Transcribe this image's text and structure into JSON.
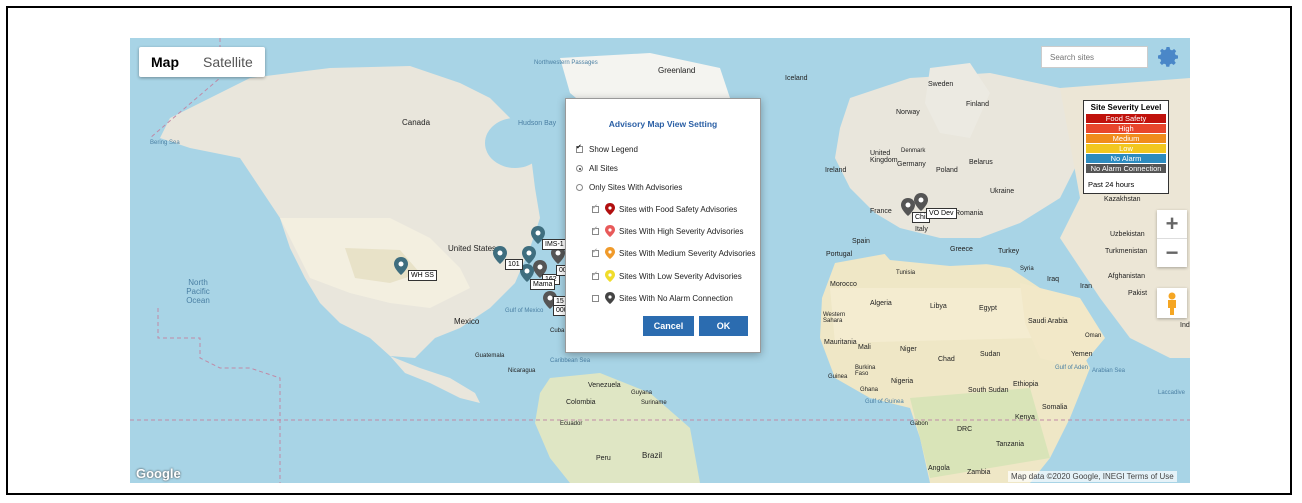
{
  "map_type": {
    "map": "Map",
    "satellite": "Satellite",
    "active": "map"
  },
  "search": {
    "placeholder": "Search sites"
  },
  "legend": {
    "title": "Site Severity Level",
    "items": [
      {
        "label": "Food Safety",
        "color": "#c0120c"
      },
      {
        "label": "High",
        "color": "#e8462c"
      },
      {
        "label": "Medium",
        "color": "#f08c1c"
      },
      {
        "label": "Low",
        "color": "#f2c71f"
      },
      {
        "label": "No Alarm",
        "color": "#2c8bbf"
      },
      {
        "label": "No Alarm Connection",
        "color": "#555555"
      }
    ],
    "period": "Past 24 hours"
  },
  "dialog": {
    "title": "Advisory Map View Setting",
    "show_legend": "Show Legend",
    "all_sites": "All Sites",
    "only_advisories": "Only Sites With Advisories",
    "food_safety": "Sites with Food Safety Advisories",
    "high": "Sites With High Severity Advisories",
    "medium": "Sites With Medium Severity Advisories",
    "low": "Sites With Low Severity Advisories",
    "no_alarm_conn": "Sites With No Alarm Connection",
    "cancel": "Cancel",
    "ok": "OK"
  },
  "zoom": {
    "in": "+",
    "out": "−"
  },
  "attribution": {
    "logo": "Google",
    "text": "Map data ©2020 Google, INEGI   Terms of Use"
  },
  "site_tags": [
    "WH SS",
    "101",
    "IMS-1",
    "162",
    "Mama",
    "00",
    "15",
    "000",
    "Chil",
    "VO Dev"
  ],
  "map_labels": {
    "greenland": "Greenland",
    "iceland": "Iceland",
    "sweden": "Sweden",
    "finland": "Finland",
    "norway": "Norway",
    "canada": "Canada",
    "hudson_bay": "Hudson Bay",
    "bering_sea": "Bering Sea",
    "nw_passages": "Northwestern Passages",
    "united_states": "United States",
    "mexico": "Mexico",
    "north_pacific": "North Pacific Ocean",
    "gulf_mexico": "Gulf of Mexico",
    "cuba": "Cuba",
    "caribbean": "Caribbean Sea",
    "guatemala": "Guatemala",
    "nicaragua": "Nicaragua",
    "venezuela": "Venezuela",
    "colombia": "Colombia",
    "guyana": "Guyana",
    "suriname": "Suriname",
    "ecuador": "Ecuador",
    "peru": "Peru",
    "brazil": "Brazil",
    "uk": "United Kingdom",
    "ireland": "Ireland",
    "denmark": "Denmark",
    "germany": "Germany",
    "poland": "Poland",
    "belarus": "Belarus",
    "ukraine": "Ukraine",
    "france": "France",
    "italy": "Italy",
    "spain": "Spain",
    "portugal": "Portugal",
    "romania": "Romania",
    "greece": "Greece",
    "turkey": "Turkey",
    "kazakhstan": "Kazakhstan",
    "uzbekistan": "Uzbekistan",
    "turkmenistan": "Turkmenistan",
    "afghanistan": "Afghanistan",
    "pakistan": "Pakist",
    "iran": "Iran",
    "iraq": "Iraq",
    "syria": "Syria",
    "tunisia": "Tunisia",
    "morocco": "Morocco",
    "algeria": "Algeria",
    "libya": "Libya",
    "egypt": "Egypt",
    "saudi": "Saudi Arabia",
    "oman": "Oman",
    "yemen": "Yemen",
    "western_sahara": "Western Sahara",
    "mauritania": "Mauritania",
    "mali": "Mali",
    "niger": "Niger",
    "chad": "Chad",
    "sudan": "Sudan",
    "south_sudan": "South Sudan",
    "ethiopia": "Ethiopia",
    "somalia": "Somalia",
    "kenya": "Kenya",
    "tanzania": "Tanzania",
    "drc": "DRC",
    "gabon": "Gabon",
    "angola": "Angola",
    "zambia": "Zambia",
    "nigeria": "Nigeria",
    "ghana": "Ghana",
    "guinea": "Guinea",
    "burkina": "Burkina Faso",
    "arabian_sea": "Arabian Sea",
    "gulf_aden": "Gulf of Aden",
    "gulf_guinea": "Gulf of Guinea",
    "ind": "Ind",
    "laccadive": "Laccadive"
  }
}
